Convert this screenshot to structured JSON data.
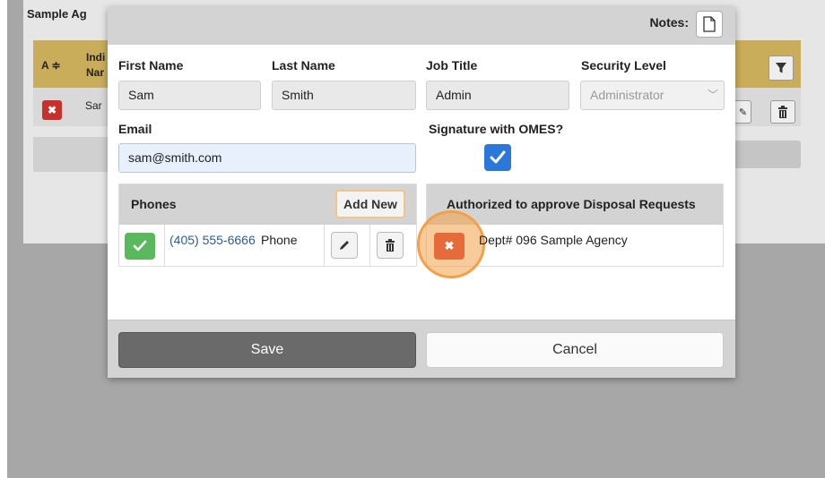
{
  "background": {
    "card_title": "Sample Ag",
    "col_a": "A ≑",
    "col_ind": "Indi Nar",
    "row_name": "Sar",
    "filter_icon": "filter-icon",
    "edit_icon": "pencil-icon",
    "trash_icon": "trash-icon"
  },
  "modal": {
    "notes_label": "Notes:",
    "notes_icon": "document-icon",
    "fields": {
      "first_name": {
        "label": "First Name",
        "value": "Sam"
      },
      "last_name": {
        "label": "Last Name",
        "value": "Smith"
      },
      "job_title": {
        "label": "Job Title",
        "value": "Admin"
      },
      "security_level": {
        "label": "Security Level",
        "value": "Administrator"
      },
      "email": {
        "label": "Email",
        "value": "sam@smith.com"
      },
      "signature": {
        "label": "Signature with OMES?",
        "checked": true
      }
    },
    "phones": {
      "title": "Phones",
      "add_new": "Add New",
      "rows": [
        {
          "number": "(405) 555-6666",
          "type": "Phone"
        }
      ]
    },
    "authorized": {
      "title": "Authorized to approve Disposal Requests",
      "rows": [
        {
          "text": "Dept# 096 Sample Agency"
        }
      ]
    },
    "footer": {
      "save": "Save",
      "cancel": "Cancel"
    }
  },
  "colors": {
    "success": "#5cb85c",
    "danger": "#e66b3a",
    "highlight": "#f2a049",
    "primary_check": "#2b78d9",
    "save_button": "#6a6a6a"
  }
}
